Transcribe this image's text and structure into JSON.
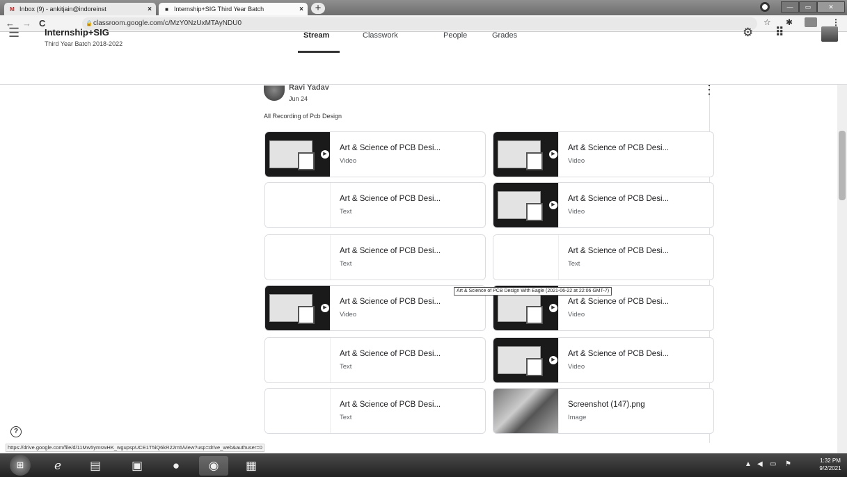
{
  "browser": {
    "tabs": [
      {
        "icon": "M",
        "label": "Inbox (9) - ankitjain@indoreinst",
        "close": "×"
      },
      {
        "icon": "■",
        "label": "Internship+SIG Third Year Batch",
        "close": "×"
      }
    ],
    "new_tab": "+",
    "url": "classroom.google.com/c/MzY0NzUxMTAyNDU0"
  },
  "header": {
    "class_title": "Internship+SIG",
    "class_subtitle": "Third Year Batch 2018-2022",
    "nav_tabs": [
      "Stream",
      "Classwork",
      "People",
      "Grades"
    ],
    "active_tab": "Stream"
  },
  "post": {
    "author": "Ravi Yadav",
    "date": "Jun 24",
    "text": "All Recording of Pcb Design",
    "attachments": [
      {
        "title": "Art & Science of PCB Desi...",
        "type": "Video",
        "thumb": "video"
      },
      {
        "title": "Art & Science of PCB Desi...",
        "type": "Video",
        "thumb": "video"
      },
      {
        "title": "Art & Science of PCB Desi...",
        "type": "Text",
        "thumb": "blank"
      },
      {
        "title": "Art & Science of PCB Desi...",
        "type": "Video",
        "thumb": "video"
      },
      {
        "title": "Art & Science of PCB Desi...",
        "type": "Text",
        "thumb": "blank"
      },
      {
        "title": "Art & Science of PCB Desi...",
        "type": "Text",
        "thumb": "blank"
      },
      {
        "title": "Art & Science of PCB Desi...",
        "type": "Video",
        "thumb": "video"
      },
      {
        "title": "Art & Science of PCB Desi...",
        "type": "Video",
        "thumb": "video"
      },
      {
        "title": "Art & Science of PCB Desi...",
        "type": "Text",
        "thumb": "blank"
      },
      {
        "title": "Art & Science of PCB Desi...",
        "type": "Video",
        "thumb": "video"
      },
      {
        "title": "Art & Science of PCB Desi...",
        "type": "Text",
        "thumb": "blank"
      },
      {
        "title": "Screenshot (147).png",
        "type": "Image",
        "thumb": "image"
      }
    ]
  },
  "tooltip": "Art & Science of PCB Design With Eagle (2021-06-22 at 22:06 GMT-7)",
  "status_url": "https://drive.google.com/file/d/11Mw5ymswHK_wgupspUCE1T5iQ6kR22m5/view?usp=drive_web&authuser=0",
  "help": "?",
  "taskbar": {
    "time": "1:32 PM",
    "date": "9/2/2021"
  },
  "icons": [
    "back-icon",
    "forward-icon",
    "reload-icon",
    "lock-icon",
    "star-icon",
    "extensions-icon",
    "menu-icon",
    "settings-icon",
    "apps-icon",
    "help-icon"
  ]
}
